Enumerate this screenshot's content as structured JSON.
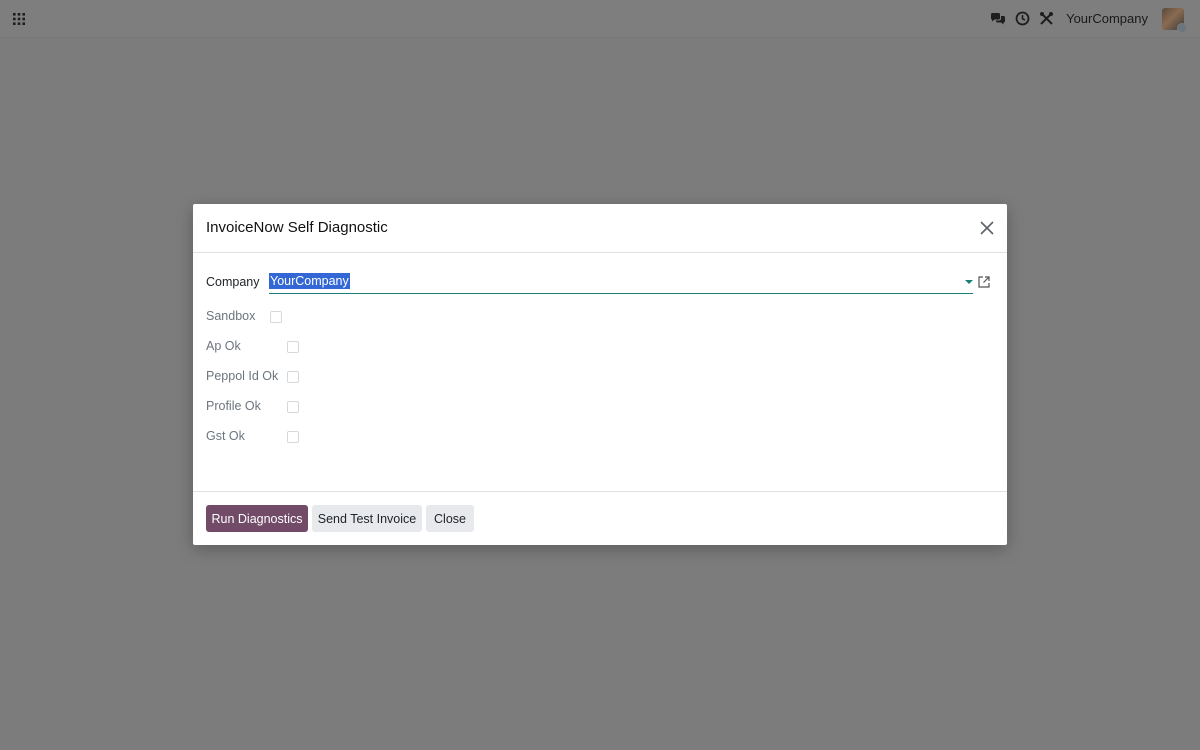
{
  "navbar": {
    "company": "YourCompany",
    "icons": [
      "apps-icon",
      "chat-icon",
      "activity-clock-icon",
      "debug-tools-icon"
    ]
  },
  "dialog": {
    "title": "InvoiceNow Self Diagnostic",
    "fields": {
      "company_label": "Company",
      "company_value": "YourCompany",
      "sandbox_label": "Sandbox",
      "ap_ok_label": "Ap Ok",
      "peppol_id_ok_label": "Peppol Id Ok",
      "profile_ok_label": "Profile Ok",
      "gst_ok_label": "Gst Ok"
    },
    "checkboxes": {
      "sandbox": false,
      "ap_ok": false,
      "peppol_id_ok": false,
      "profile_ok": false,
      "gst_ok": false
    },
    "buttons": {
      "run": "Run Diagnostics",
      "send_test": "Send Test Invoice",
      "close": "Close"
    }
  },
  "colors": {
    "primary": "#714b67",
    "accent": "#1b7f79",
    "selection": "#3367d6",
    "backdrop": "#7b7c7b"
  }
}
